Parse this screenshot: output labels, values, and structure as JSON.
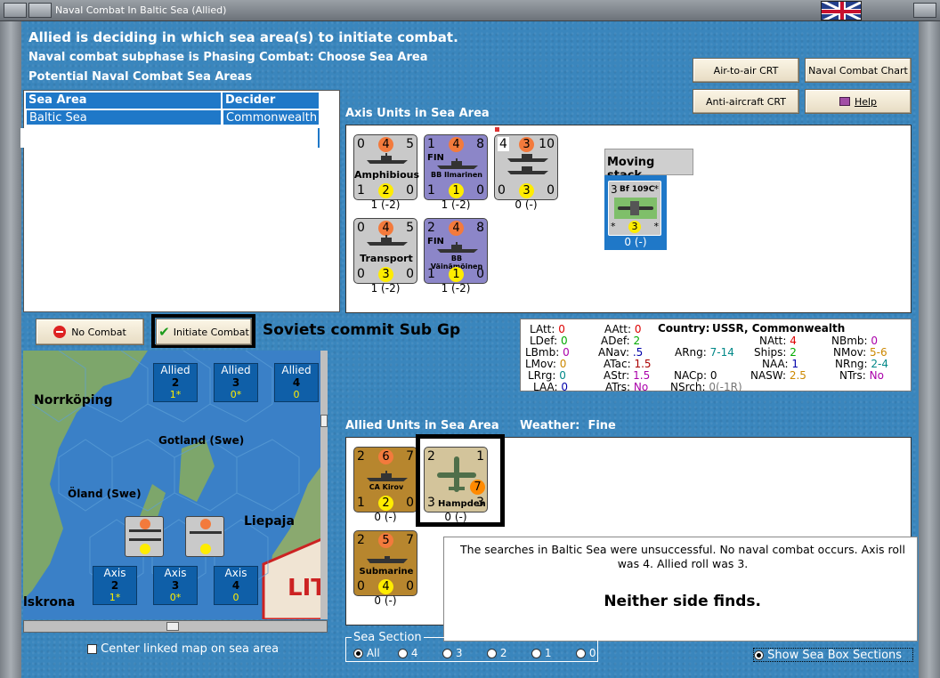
{
  "window": {
    "title": "Naval Combat In Baltic Sea (Allied)"
  },
  "header": {
    "line1": "Allied is deciding in which sea area(s) to initiate combat.",
    "line2": "Naval combat subphase is Phasing Combat: Choose Sea Area",
    "line3": "Potential Naval Combat Sea Areas"
  },
  "buttons": {
    "air_to_air": "Air-to-air CRT",
    "naval_chart": "Naval Combat Chart",
    "anti_aircraft": "Anti-aircraft CRT",
    "help": "Help",
    "no_combat": "No Combat",
    "initiate_combat": "Initiate Combat"
  },
  "sea_table": {
    "headers": [
      "Sea Area",
      "Decider"
    ],
    "rows": [
      [
        "Baltic Sea",
        "Commonwealth"
      ]
    ]
  },
  "axis_panel": {
    "label": "Axis Units in Sea Area",
    "units": [
      {
        "tl": "0",
        "tc": "4",
        "tr": "5",
        "name": "Amphibious",
        "nation": "",
        "bl": "1",
        "bc": "2",
        "br": "0",
        "caption": "1 (-2)"
      },
      {
        "tl": "1",
        "tc": "4",
        "tr": "8",
        "name": "BB Ilmarinen",
        "nation": "FIN",
        "bl": "1",
        "bc": "1",
        "br": "0",
        "caption": "1 (-2)"
      },
      {
        "tl": "4",
        "tc": "3",
        "tr": "10",
        "name": "",
        "nation": "",
        "bl": "0",
        "bc": "3",
        "br": "0",
        "caption": "0 (-)"
      },
      {
        "tl": "0",
        "tc": "4",
        "tr": "5",
        "name": "Transport",
        "nation": "",
        "bl": "0",
        "bc": "3",
        "br": "0",
        "caption": "1 (-2)"
      },
      {
        "tl": "2",
        "tc": "4",
        "tr": "8",
        "name": "BB Väinämöinen",
        "nation": "FIN",
        "bl": "1",
        "bc": "1",
        "br": "0",
        "caption": "1 (-2)"
      }
    ],
    "moving_stack": {
      "label": "Moving stack",
      "tl": "3",
      "name": "Bf 109C",
      "tr": "*",
      "bl": "*",
      "bc": "3",
      "br": "*",
      "caption": "0 (-)"
    }
  },
  "soviets_text": "Soviets commit Sub Gp",
  "stats": {
    "LAtt": "0",
    "LDef": "0",
    "LBmb": "0",
    "LMov": "0",
    "LRrg": "0",
    "LAA": "0",
    "AAtt": "0",
    "ADef": "2",
    "ANav": ".5",
    "ATac": "1.5",
    "AStr": "1.5",
    "ATrs": "No",
    "country_label": "Country:",
    "country": "USSR, Commonwealth",
    "ARng": "7-14",
    "NACp": "0",
    "NSrch": "0(-1R)",
    "NAtt": "4",
    "Ships": "2",
    "NAA": "1",
    "NASW": "2.5",
    "NBmb": "0",
    "NMov": "5-6",
    "NRng": "2-4",
    "NTrs": "No"
  },
  "weather": {
    "label": "Weather:",
    "value": "Fine"
  },
  "allied_panel": {
    "label": "Allied Units in Sea Area",
    "units": [
      {
        "tl": "2",
        "tc": "6",
        "tr": "7",
        "name": "CA Kirov",
        "bl": "1",
        "bc": "2",
        "br": "0",
        "caption": "0 (-)"
      },
      {
        "tl": "2",
        "tc": "",
        "tr": "1",
        "name": "Hampden",
        "bl": "3",
        "bc": "7",
        "br": "3",
        "caption": "0 (-)"
      },
      {
        "tl": "2",
        "tc": "5",
        "tr": "7",
        "name": "Submarine",
        "bl": "0",
        "bc": "4",
        "br": "0",
        "caption": "0 (-)"
      }
    ]
  },
  "message": {
    "line": "The searches in Baltic Sea were unsuccessful.  No naval combat occurs.  Axis roll was 4.  Allied roll was 3.",
    "result": "Neither side finds."
  },
  "map": {
    "labels": [
      "Norrköping",
      "Gotland (Swe)",
      "Öland (Swe)",
      "Liepaja",
      "lskrona",
      "LIT"
    ],
    "allied_boxes": [
      {
        "t": "Allied",
        "v1": "2",
        "v2": "1*"
      },
      {
        "t": "Allied",
        "v1": "3",
        "v2": "0*"
      },
      {
        "t": "Allied",
        "v1": "4",
        "v2": "0"
      }
    ],
    "axis_boxes": [
      {
        "t": "Axis",
        "v1": "2",
        "v2": "1*"
      },
      {
        "t": "Axis",
        "v1": "3",
        "v2": "0*"
      },
      {
        "t": "Axis",
        "v1": "4",
        "v2": "0"
      }
    ]
  },
  "footer": {
    "center_map": "Center linked map on sea area",
    "sea_section": "Sea Section",
    "options": [
      "All",
      "4",
      "3",
      "2",
      "1",
      "0"
    ],
    "show_boxes": "Show Sea Box Sections"
  },
  "colors": {
    "accent": "#1f78c8",
    "background": "#3a86bd"
  }
}
